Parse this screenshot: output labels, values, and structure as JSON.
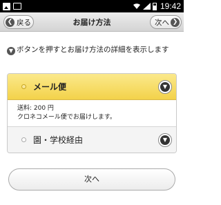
{
  "status_bar": {
    "time": "19:42"
  },
  "header": {
    "back_label": "戻る",
    "title": "お届け方法",
    "next_label": "次へ"
  },
  "intro": {
    "text": "ボタンを押すとお届け方法の詳細を表示します"
  },
  "options": [
    {
      "label": "メール便",
      "selected": true
    },
    {
      "label": "園・学校経由",
      "selected": false
    }
  ],
  "detail": {
    "line1": "送料: 200 円",
    "line2": "クロネコメール便でお届けします。"
  },
  "footer": {
    "next_label": "次へ"
  },
  "colors": {
    "selected_row": "#f3d24a",
    "header_bg": "#dcdcdc",
    "icon_dark": "#555555"
  }
}
